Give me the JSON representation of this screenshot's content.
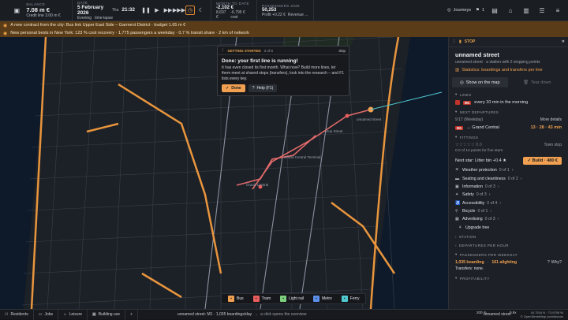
{
  "topbar": {
    "balance_caption": "BALANCE",
    "balance_value": "7.08 m €",
    "credit_line": "Credit line 3.00 m €",
    "date_caption": "DATE",
    "date_value": "5 February 2026",
    "weekday": "Thu",
    "time": "21:32",
    "time_of_day": "Evening",
    "time_mode": "time-lapse",
    "month_caption": "MONTH TO DATE",
    "month_value": "-2,102 €",
    "month_income": "8,697 €",
    "month_expense": "-6,795 € cost",
    "pax_caption": "PASSENGERS 2026",
    "pax_value": "50,253",
    "pax_profit": "Profit +0.22 €",
    "pax_revenue": "Revenue ...",
    "journeys_label": "Journeys",
    "count_label": "1"
  },
  "ticker": [
    {
      "icon": "contract-icon",
      "text": "A new contract from the city: Bus link Upper East Side – Garment District · budget 1.65 m €"
    },
    {
      "icon": "trophy-icon",
      "text": "New personal bests in New York: 123 % cost recovery · 1,775 passengers a weekday · 0.7 % transit share · 2 km of network"
    }
  ],
  "tutorial": {
    "caption": "GETTING STARTED",
    "progress": "3 of 8",
    "skip_label": "Skip",
    "title": "Done: your first line is running!",
    "body": "It has even closed its first month. What now? Build more lines, let them meet at shared stops (transfers), look into the research – and F1 lists every key.",
    "done_label": "Done",
    "help_label": "Help (F1)"
  },
  "panel": {
    "caption": "STOP",
    "title": "unnamed street",
    "subtitle": "unnamed street · a station with 2 stopping points",
    "stats_link": "Statistics: boardings and transfers per line",
    "show_map_label": "Show on the map",
    "tear_down_label": "Tear down",
    "lines_caption": "LINES",
    "line_badge": "M1",
    "line_text": "every 10 min in the morning",
    "departures_caption": "NEXT DEPARTURES",
    "departures_time": "9:17 (Weekday)",
    "more_details": "More details",
    "dep_badge": "M1",
    "dep_dest": "→ Grand Central",
    "dep_times": "13 · 28 · 43 min",
    "fittings_caption": "FITTINGS",
    "stars": "☆☆☆☆☆ 0.0",
    "town_stop": "Town stop",
    "fittings_count": "0.0 of 14 points for five stars",
    "next_star": "Next star: Litter bin +0.4 ★",
    "build_label": "Build · 480 €",
    "fittings": [
      {
        "icon": "umbrella-icon",
        "label": "Weather protection",
        "count": "0 of 1"
      },
      {
        "icon": "seat-icon",
        "label": "Seating and cleanliness",
        "count": "0 of 2"
      },
      {
        "icon": "info-icon",
        "label": "Information",
        "count": "0 of 3"
      },
      {
        "icon": "safety-icon",
        "label": "Safety",
        "count": "0 of 3"
      },
      {
        "icon": "access-icon",
        "label": "Accessibility",
        "count": "0 of 4"
      },
      {
        "icon": "bike-icon",
        "label": "Bicycle",
        "count": "0 of 1"
      },
      {
        "icon": "ad-icon",
        "label": "Advertising",
        "count": "0 of 3"
      }
    ],
    "upgrade_label": "Upgrade tree",
    "station_caption": "STATION",
    "dep_hour_caption": "DEPARTURES PER HOUR",
    "pax_weekday_caption": "PASSENGERS PER WEEKDAY",
    "boarding": "1,035 boarding",
    "alighting": "161 alighting",
    "why_label": "Why?",
    "transfers": "Transfers: none.",
    "profitability_caption": "PROFITABILITY"
  },
  "map_labels": {
    "stop1": "unnamed street",
    "stop2": "Grand Central Terminal",
    "stop3": "Grand Central",
    "stop4": "Stop Street"
  },
  "modes": [
    {
      "label": "Bus",
      "color": "#f0a050",
      "icon": "bus-icon"
    },
    {
      "label": "Tram",
      "color": "#e85d5d",
      "icon": "tram-icon"
    },
    {
      "label": "Light rail",
      "color": "#7ed07e",
      "icon": "lightrail-icon"
    },
    {
      "label": "Metro",
      "color": "#5b8fe8",
      "icon": "metro-icon"
    },
    {
      "label": "Ferry",
      "color": "#4fc8d0",
      "icon": "ferry-icon"
    }
  ],
  "bottombar": {
    "residents": "Residents",
    "jobs": "Jobs",
    "leisure": "Leisure",
    "building": "Building use",
    "status": "unnamed street: M1 · 1,035 boardings/day",
    "hint": "a click opens the overview",
    "scale": "200 m",
    "location": "unnamed street",
    "coords": "40.7516 N · 73.9758 W",
    "attribution": "© OpenStreetMap contributors",
    "zoom": "0.9x"
  }
}
